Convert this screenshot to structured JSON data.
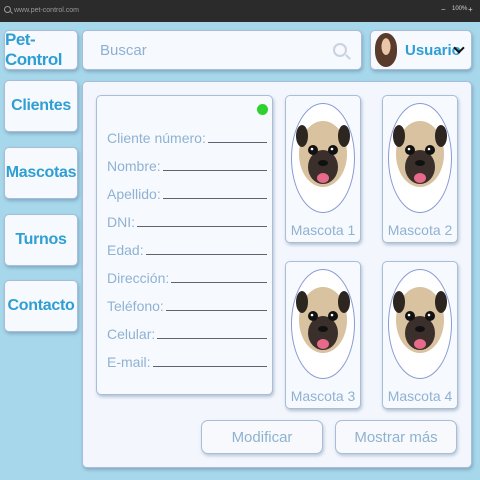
{
  "browser": {
    "url": "www.pet-control.com",
    "zoom": "100%",
    "minimize": "−",
    "add": "+"
  },
  "app": {
    "logo": "Pet-Control"
  },
  "search": {
    "placeholder": "Buscar"
  },
  "user": {
    "name": "Usuario"
  },
  "nav": [
    "Clientes",
    "Mascotas",
    "Turnos",
    "Contacto"
  ],
  "client_form": {
    "status_color": "#2fd12f",
    "fields": [
      "Cliente número:",
      "Nombre:",
      "Apellido:",
      "DNI:",
      "Edad:",
      "Dirección:",
      "Teléfono:",
      "Celular:",
      "E-mail:"
    ]
  },
  "pets": [
    "Mascota 1",
    "Mascota 2",
    "Mascota 3",
    "Mascota 4"
  ],
  "buttons": {
    "modify": "Modificar",
    "show_more": "Mostrar más"
  },
  "colors": {
    "accent": "#2f9fd3",
    "label": "#8fb2d2",
    "background": "#a7d7ea"
  }
}
